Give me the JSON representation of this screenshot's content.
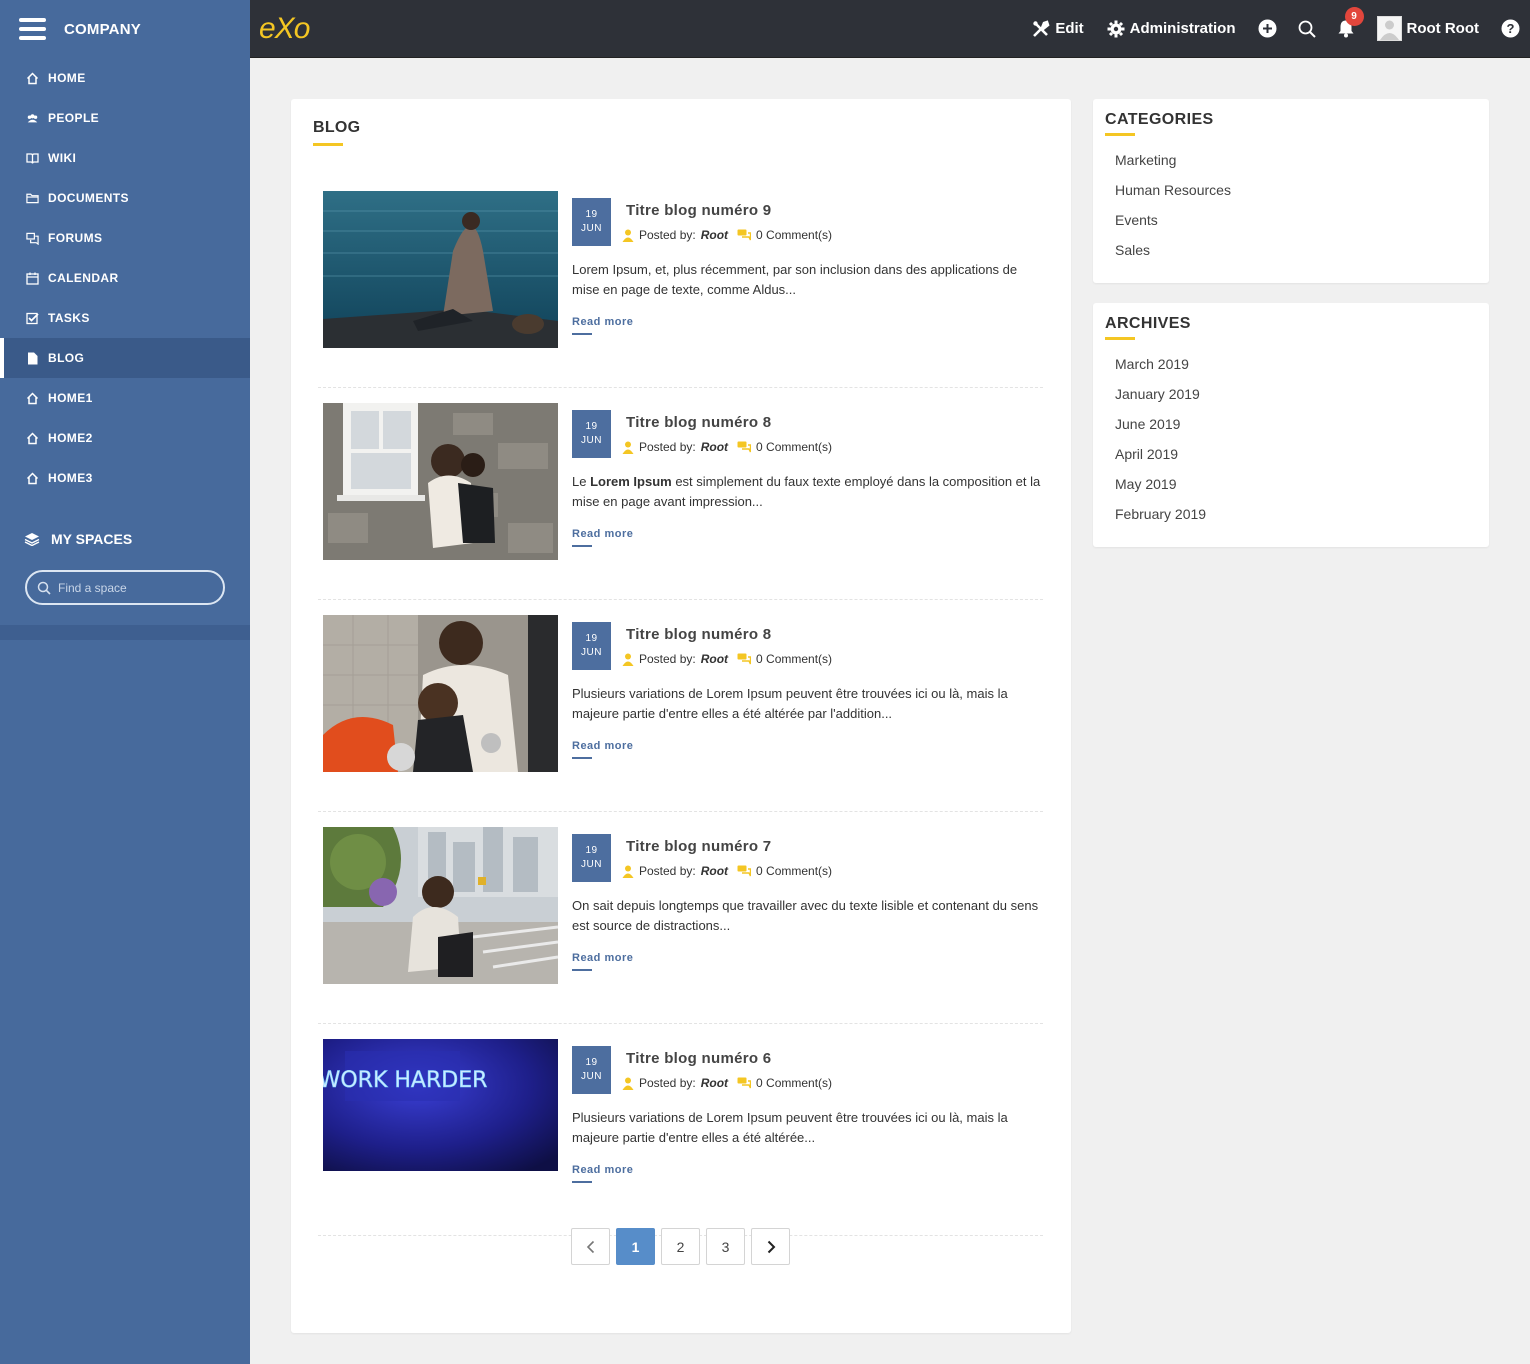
{
  "sidebar": {
    "company": "COMPANY",
    "items": [
      {
        "label": "HOME",
        "icon": "home-icon"
      },
      {
        "label": "PEOPLE",
        "icon": "people-icon"
      },
      {
        "label": "WIKI",
        "icon": "book-icon"
      },
      {
        "label": "DOCUMENTS",
        "icon": "folder-icon"
      },
      {
        "label": "FORUMS",
        "icon": "forum-icon"
      },
      {
        "label": "CALENDAR",
        "icon": "calendar-icon"
      },
      {
        "label": "TASKS",
        "icon": "checkbox-icon"
      },
      {
        "label": "BLOG",
        "icon": "document-icon",
        "active": true
      },
      {
        "label": "HOME1",
        "icon": "home-icon"
      },
      {
        "label": "HOME2",
        "icon": "home-icon"
      },
      {
        "label": "HOME3",
        "icon": "home-icon"
      }
    ],
    "my_spaces": "MY SPACES",
    "search_placeholder": "Find a space"
  },
  "topbar": {
    "logo": "eXo",
    "edit": "Edit",
    "administration": "Administration",
    "notification_count": "9",
    "user_name": "Root Root"
  },
  "blog": {
    "title": "BLOG",
    "posted_by_label": "Posted by:",
    "read_more": "Read more",
    "posts": [
      {
        "day": "19",
        "month": "JUN",
        "title": "Titre blog numéro 9",
        "author": "Root",
        "comments": "0 Comment(s)",
        "excerpt_pre": "",
        "excerpt_bold": "",
        "excerpt": "Lorem Ipsum, et, plus récemment, par son inclusion dans des applications de mise en page de texte, comme Aldus..."
      },
      {
        "day": "19",
        "month": "JUN",
        "title": "Titre blog numéro 8",
        "author": "Root",
        "comments": "0 Comment(s)",
        "excerpt_pre": "Le ",
        "excerpt_bold": "Lorem Ipsum",
        "excerpt": " est simplement du faux texte employé dans la composition et la mise en page avant impression..."
      },
      {
        "day": "19",
        "month": "JUN",
        "title": "Titre blog numéro 8",
        "author": "Root",
        "comments": "0 Comment(s)",
        "excerpt_pre": "",
        "excerpt_bold": "",
        "excerpt": "Plusieurs variations de Lorem Ipsum peuvent être trouvées ici ou là, mais la majeure partie d'entre elles a été altérée par l'addition..."
      },
      {
        "day": "19",
        "month": "JUN",
        "title": "Titre blog numéro 7",
        "author": "Root",
        "comments": "0 Comment(s)",
        "excerpt_pre": "",
        "excerpt_bold": "",
        "excerpt": "On sait depuis longtemps que travailler avec du texte lisible et contenant du sens est source de distractions..."
      },
      {
        "day": "19",
        "month": "JUN",
        "title": "Titre blog numéro 6",
        "author": "Root",
        "comments": "0 Comment(s)",
        "excerpt_pre": "",
        "excerpt_bold": "",
        "excerpt": "Plusieurs variations de Lorem Ipsum peuvent être trouvées ici ou là, mais la majeure partie d'entre elles a été altérée..."
      }
    ],
    "neon_text": "WORK HARDER",
    "pagination": {
      "pages": [
        "1",
        "2",
        "3"
      ],
      "current": "1"
    }
  },
  "categories": {
    "title": "CATEGORIES",
    "items": [
      "Marketing",
      "Human Resources",
      "Events",
      "Sales"
    ]
  },
  "archives": {
    "title": "ARCHIVES",
    "items": [
      "March 2019",
      "January 2019",
      "June 2019",
      "April 2019",
      "May 2019",
      "February 2019"
    ]
  },
  "colors": {
    "sidebar": "#476a9c",
    "topbar": "#2e3138",
    "accent": "#f4c623",
    "date_box": "#4d6e9f",
    "page_active": "#578dc9",
    "badge": "#e2463c"
  }
}
